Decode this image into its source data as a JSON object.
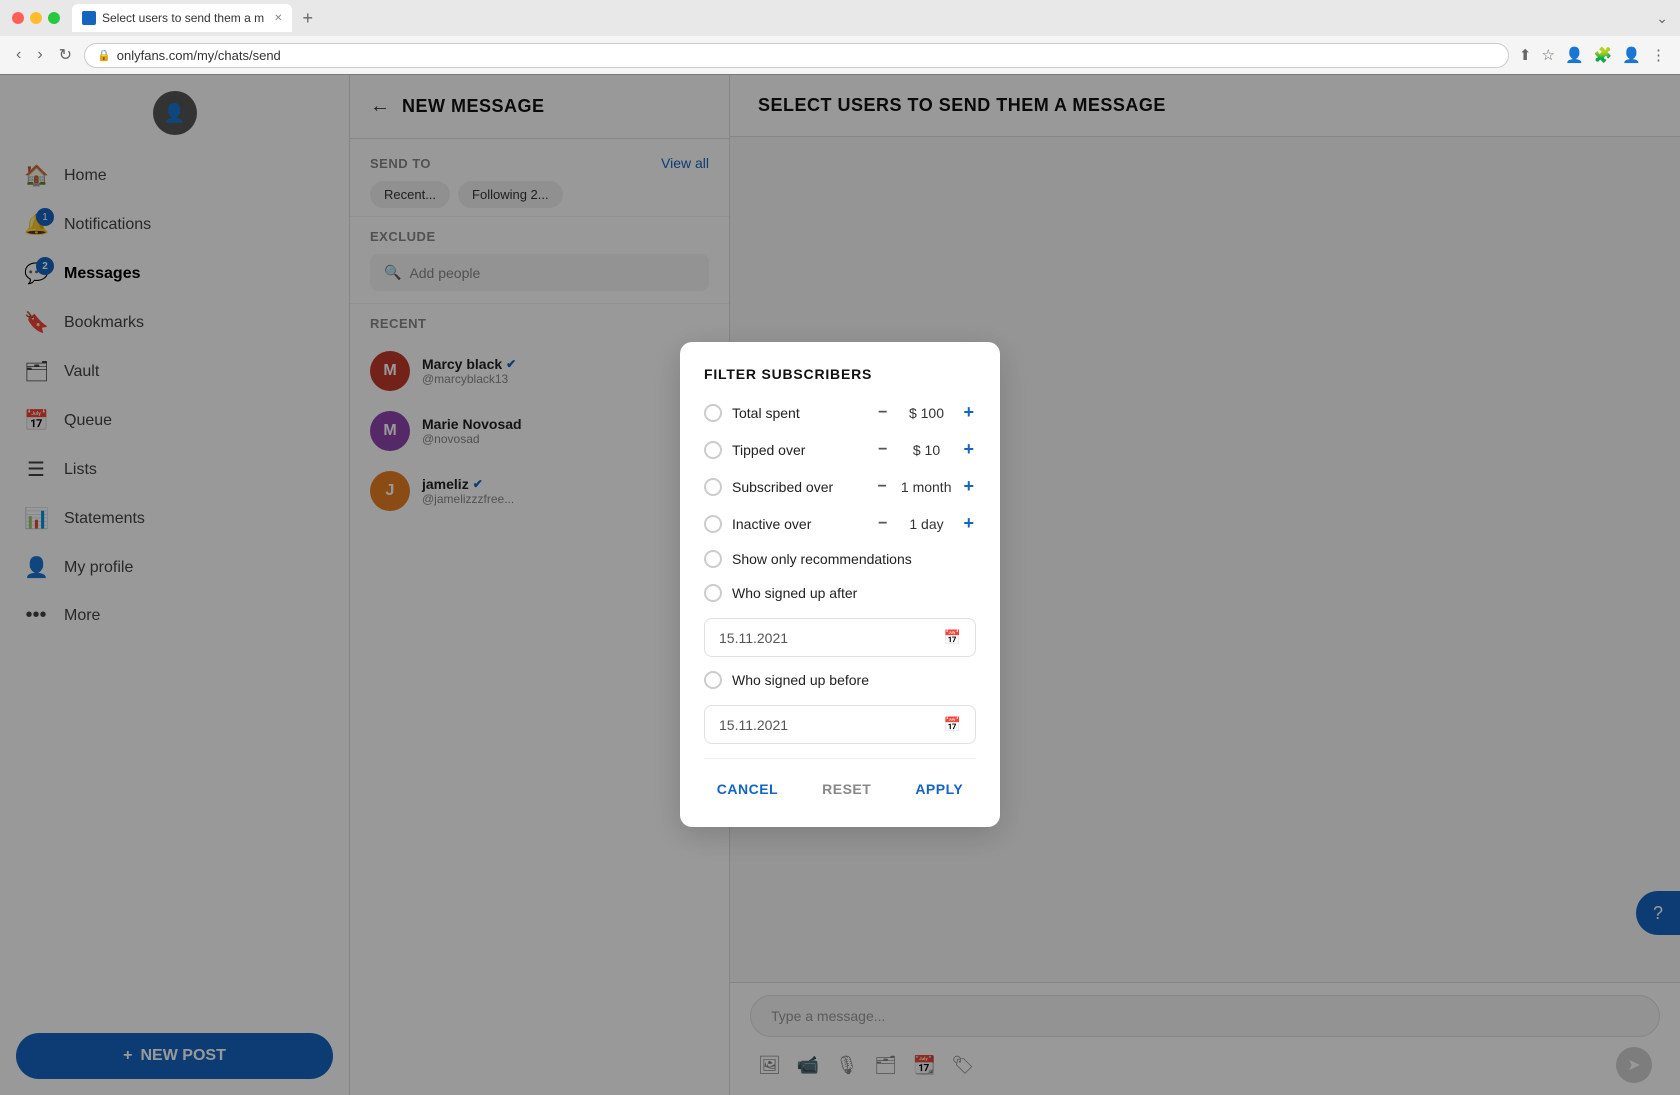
{
  "browser": {
    "tab_title": "Select users to send them a m",
    "url": "onlyfans.com/my/chats/send",
    "new_tab_label": "+"
  },
  "sidebar": {
    "nav_items": [
      {
        "id": "home",
        "icon": "🏠",
        "label": "Home",
        "badge": null
      },
      {
        "id": "notifications",
        "icon": "🔔",
        "label": "Notifications",
        "badge": "1"
      },
      {
        "id": "messages",
        "icon": "💬",
        "label": "Messages",
        "badge": "2",
        "active": true
      },
      {
        "id": "bookmarks",
        "icon": "🔖",
        "label": "Bookmarks",
        "badge": null
      },
      {
        "id": "vault",
        "icon": "🗂",
        "label": "Vault",
        "badge": null
      },
      {
        "id": "queue",
        "icon": "📅",
        "label": "Queue",
        "badge": null
      },
      {
        "id": "lists",
        "icon": "☰",
        "label": "Lists",
        "badge": null
      },
      {
        "id": "statements",
        "icon": "📊",
        "label": "Statements",
        "badge": null
      },
      {
        "id": "my-profile",
        "icon": "👤",
        "label": "My profile",
        "badge": null
      },
      {
        "id": "more",
        "icon": "•••",
        "label": "More",
        "badge": null
      }
    ],
    "new_post_label": "NEW POST"
  },
  "new_message": {
    "back_label": "←",
    "title": "NEW MESSAGE",
    "send_to_label": "SEND TO",
    "view_all_label": "View all",
    "chips": [
      "Recent...",
      "Following 2..."
    ],
    "exclude_label": "EXCLUDE",
    "search_placeholder": "Add people",
    "recent_label": "RECENT",
    "recent_items": [
      {
        "name": "Marcy black",
        "handle": "@marcyblack13",
        "verified": true,
        "color": "#c0392b"
      },
      {
        "name": "Marie Novosad",
        "handle": "@novosad",
        "verified": false,
        "color": "#8e44ad"
      },
      {
        "name": "jameliz",
        "handle": "@jamelizzzfree...",
        "verified": true,
        "color": "#e67e22"
      }
    ]
  },
  "right_panel": {
    "title": "SELECT USERS TO SEND THEM A MESSAGE",
    "message_placeholder": "Type a message..."
  },
  "modal": {
    "title": "FILTER SUBSCRIBERS",
    "filters": [
      {
        "id": "total-spent",
        "label": "Total spent",
        "value": "$ 100",
        "has_controls": true
      },
      {
        "id": "tipped-over",
        "label": "Tipped over",
        "value": "$ 10",
        "has_controls": true
      },
      {
        "id": "subscribed-over",
        "label": "Subscribed over",
        "value": "1 month",
        "has_controls": true
      },
      {
        "id": "inactive-over",
        "label": "Inactive over",
        "value": "1 day",
        "has_controls": true
      }
    ],
    "checkbox_items": [
      {
        "id": "show-recommendations",
        "label": "Show only recommendations"
      },
      {
        "id": "signed-up-after",
        "label": "Who signed up after"
      },
      {
        "id": "signed-up-before",
        "label": "Who signed up before"
      }
    ],
    "date_after": "15.11.2021",
    "date_before": "15.11.2021",
    "cancel_label": "CANCEL",
    "reset_label": "RESET",
    "apply_label": "APPLY"
  }
}
